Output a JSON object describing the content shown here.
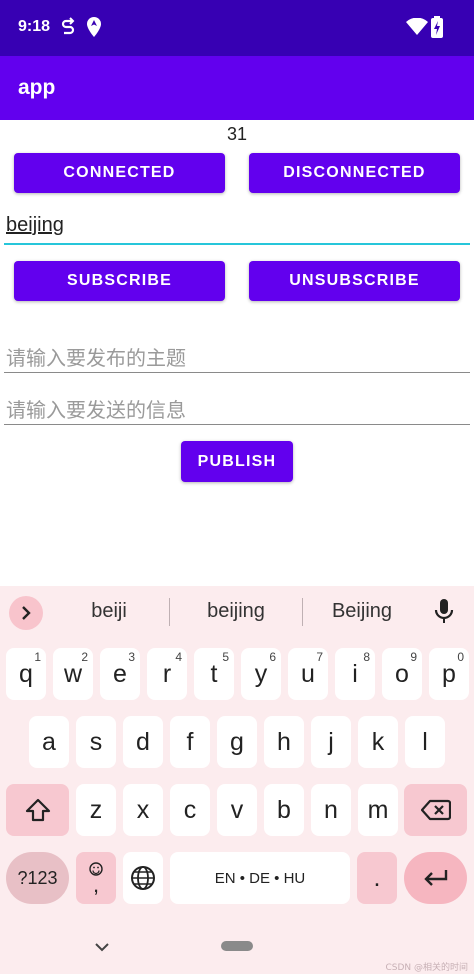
{
  "status_bar": {
    "time": "9:18"
  },
  "app_bar": {
    "title": "app"
  },
  "counter": "31",
  "buttons": {
    "connected": "CONNECTED",
    "disconnected": "DISCONNECTED",
    "subscribe": "SUBSCRIBE",
    "unsubscribe": "UNSUBSCRIBE",
    "publish": "PUBLISH"
  },
  "fields": {
    "topic_value": "beijing",
    "publish_topic_placeholder": "请输入要发布的主题",
    "message_placeholder": "请输入要发送的信息"
  },
  "keyboard": {
    "suggestions": [
      "beiji",
      "beijing",
      "Beijing"
    ],
    "row1": [
      {
        "k": "q",
        "h": "1"
      },
      {
        "k": "w",
        "h": "2"
      },
      {
        "k": "e",
        "h": "3"
      },
      {
        "k": "r",
        "h": "4"
      },
      {
        "k": "t",
        "h": "5"
      },
      {
        "k": "y",
        "h": "6"
      },
      {
        "k": "u",
        "h": "7"
      },
      {
        "k": "i",
        "h": "8"
      },
      {
        "k": "o",
        "h": "9"
      },
      {
        "k": "p",
        "h": "0"
      }
    ],
    "row2": [
      "a",
      "s",
      "d",
      "f",
      "g",
      "h",
      "j",
      "k",
      "l"
    ],
    "row3": [
      "z",
      "x",
      "c",
      "v",
      "b",
      "n",
      "m"
    ],
    "symbols_label": "?123",
    "emoji_comma": ",",
    "space_label": "EN • DE • HU",
    "period": "."
  },
  "watermark": "CSDN @相关的时间"
}
